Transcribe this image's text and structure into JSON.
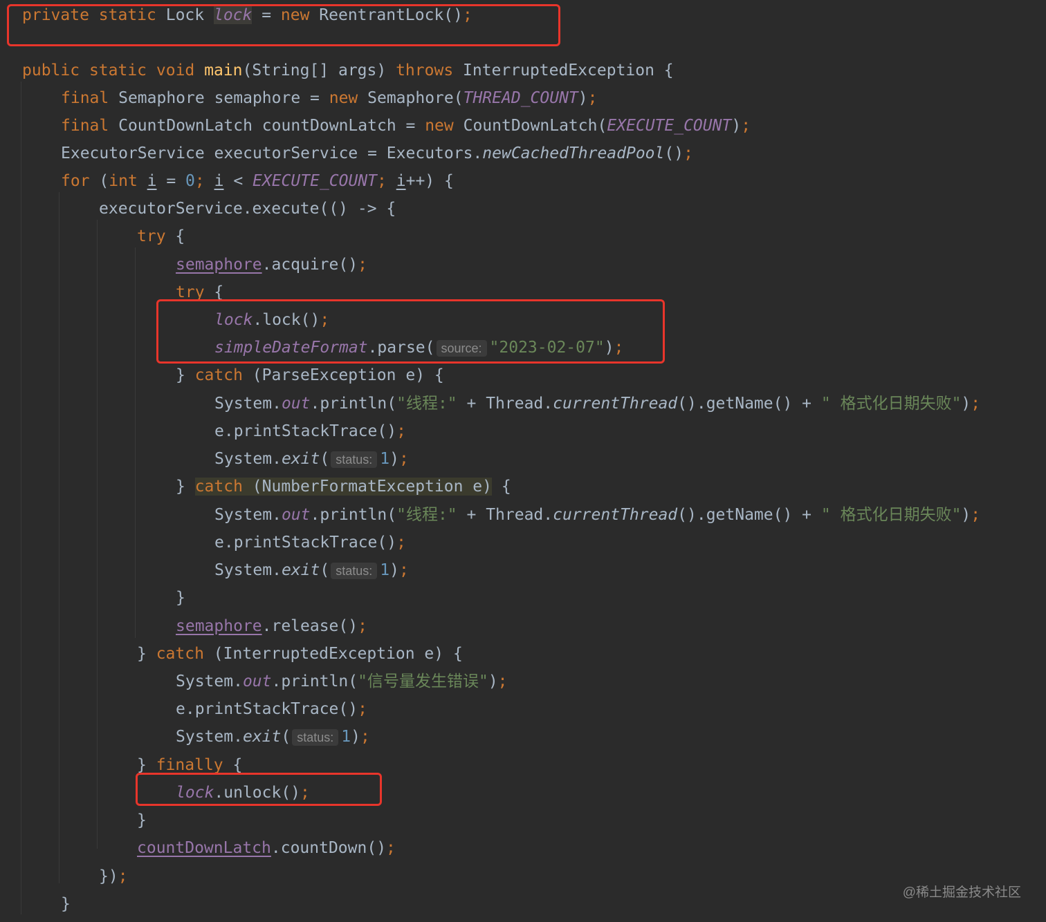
{
  "editor": {
    "theme": "Darcula",
    "colors": {
      "background": "#2b2b2b",
      "keyword": "#cc7832",
      "text": "#a9b7c6",
      "method_declaration": "#ffc66d",
      "static_field": "#9876aa",
      "string": "#6a8759",
      "number": "#6897bb",
      "parameter_hint": "#8c8c8c",
      "annotation_box": "#e8352b"
    },
    "lines": [
      [
        [
          "kw",
          "private "
        ],
        [
          "kw",
          "static "
        ],
        [
          "plain",
          "Lock "
        ],
        [
          "static_field_usage",
          "lock"
        ],
        [
          "plain",
          " = "
        ],
        [
          "kw",
          "new "
        ],
        [
          "plain",
          "ReentrantLock()"
        ],
        [
          "punc",
          ";"
        ]
      ],
      [
        [
          "kw",
          "public "
        ],
        [
          "kw",
          "static "
        ],
        [
          "kw",
          "void "
        ],
        [
          "fn",
          "main"
        ],
        [
          "plain",
          "(String[] args) "
        ],
        [
          "kw",
          "throws "
        ],
        [
          "plain",
          "InterruptedException {"
        ]
      ],
      [
        [
          "kw",
          "final "
        ],
        [
          "plain",
          "Semaphore semaphore = "
        ],
        [
          "kw",
          "new "
        ],
        [
          "plain",
          "Semaphore("
        ],
        [
          "static_field",
          "THREAD_COUNT"
        ],
        [
          "plain",
          ")"
        ],
        [
          "punc",
          ";"
        ]
      ],
      [
        [
          "kw",
          "final "
        ],
        [
          "plain",
          "CountDownLatch countDownLatch = "
        ],
        [
          "kw",
          "new "
        ],
        [
          "plain",
          "CountDownLatch("
        ],
        [
          "static_field",
          "EXECUTE_COUNT"
        ],
        [
          "plain",
          ")"
        ],
        [
          "punc",
          ";"
        ]
      ],
      [
        [
          "plain",
          "ExecutorService executorService = Executors."
        ],
        [
          "static_method",
          "newCachedThreadPool"
        ],
        [
          "plain",
          "()"
        ],
        [
          "punc",
          ";"
        ]
      ],
      [
        [
          "kw",
          "for "
        ],
        [
          "plain",
          "("
        ],
        [
          "kw",
          "int "
        ],
        [
          "var_ul",
          "i"
        ],
        [
          "plain",
          " = "
        ],
        [
          "number",
          "0"
        ],
        [
          "punc",
          "; "
        ],
        [
          "var_ul",
          "i"
        ],
        [
          "plain",
          " < "
        ],
        [
          "static_field",
          "EXECUTE_COUNT"
        ],
        [
          "punc",
          "; "
        ],
        [
          "var_ul",
          "i"
        ],
        [
          "plain",
          "++) {"
        ]
      ],
      [
        [
          "plain",
          "executorService.execute(() -> {"
        ]
      ],
      [
        [
          "kw",
          "try "
        ],
        [
          "plain",
          "{"
        ]
      ],
      [
        [
          "field_ul",
          "semaphore"
        ],
        [
          "plain",
          ".acquire()"
        ],
        [
          "punc",
          ";"
        ]
      ],
      [
        [
          "kw",
          "try "
        ],
        [
          "plain",
          "{"
        ]
      ],
      [
        [
          "static_field",
          "lock"
        ],
        [
          "plain",
          ".lock()"
        ],
        [
          "punc",
          ";"
        ]
      ],
      [
        [
          "static_field",
          "simpleDateFormat"
        ],
        [
          "plain",
          ".parse("
        ],
        [
          "hint",
          "source:"
        ],
        [
          "string",
          "\"2023-02-07\""
        ],
        [
          "plain",
          ")"
        ],
        [
          "punc",
          ";"
        ]
      ],
      [
        [
          "plain",
          "} "
        ],
        [
          "kw",
          "catch "
        ],
        [
          "plain",
          "(ParseException e) {"
        ]
      ],
      [
        [
          "plain",
          "System."
        ],
        [
          "static_field",
          "out"
        ],
        [
          "plain",
          ".println("
        ],
        [
          "string",
          "\"线程:\""
        ],
        [
          "plain",
          " + Thread."
        ],
        [
          "static_method",
          "currentThread"
        ],
        [
          "plain",
          "().getName() + "
        ],
        [
          "string",
          "\" 格式化日期失败\""
        ],
        [
          "plain",
          ")"
        ],
        [
          "punc",
          ";"
        ]
      ],
      [
        [
          "plain",
          "e.printStackTrace()"
        ],
        [
          "punc",
          ";"
        ]
      ],
      [
        [
          "plain",
          "System."
        ],
        [
          "static_method",
          "exit"
        ],
        [
          "plain",
          "("
        ],
        [
          "hint",
          "status:"
        ],
        [
          "number",
          "1"
        ],
        [
          "plain",
          ")"
        ],
        [
          "punc",
          ";"
        ]
      ],
      [
        [
          "plain",
          "} "
        ],
        [
          "kw_catch_hl",
          "catch "
        ],
        [
          "catch_hl",
          "(NumberFormatException e)"
        ],
        [
          "plain",
          " {"
        ]
      ],
      [
        [
          "plain",
          "System."
        ],
        [
          "static_field",
          "out"
        ],
        [
          "plain",
          ".println("
        ],
        [
          "string",
          "\"线程:\""
        ],
        [
          "plain",
          " + Thread."
        ],
        [
          "static_method",
          "currentThread"
        ],
        [
          "plain",
          "().getName() + "
        ],
        [
          "string",
          "\" 格式化日期失败\""
        ],
        [
          "plain",
          ")"
        ],
        [
          "punc",
          ";"
        ]
      ],
      [
        [
          "plain",
          "e.printStackTrace()"
        ],
        [
          "punc",
          ";"
        ]
      ],
      [
        [
          "plain",
          "System."
        ],
        [
          "static_method",
          "exit"
        ],
        [
          "plain",
          "("
        ],
        [
          "hint",
          "status:"
        ],
        [
          "number",
          "1"
        ],
        [
          "plain",
          ")"
        ],
        [
          "punc",
          ";"
        ]
      ],
      [
        [
          "plain",
          "}"
        ]
      ],
      [
        [
          "field_ul",
          "semaphore"
        ],
        [
          "plain",
          ".release()"
        ],
        [
          "punc",
          ";"
        ]
      ],
      [
        [
          "plain",
          "} "
        ],
        [
          "kw",
          "catch "
        ],
        [
          "plain",
          "(InterruptedException e) {"
        ]
      ],
      [
        [
          "plain",
          "System."
        ],
        [
          "static_field",
          "out"
        ],
        [
          "plain",
          ".println("
        ],
        [
          "string",
          "\"信号量发生错误\""
        ],
        [
          "plain",
          ")"
        ],
        [
          "punc",
          ";"
        ]
      ],
      [
        [
          "plain",
          "e.printStackTrace()"
        ],
        [
          "punc",
          ";"
        ]
      ],
      [
        [
          "plain",
          "System."
        ],
        [
          "static_method",
          "exit"
        ],
        [
          "plain",
          "("
        ],
        [
          "hint",
          "status:"
        ],
        [
          "number",
          "1"
        ],
        [
          "plain",
          ")"
        ],
        [
          "punc",
          ";"
        ]
      ],
      [
        [
          "plain",
          "} "
        ],
        [
          "kw",
          "finally "
        ],
        [
          "plain",
          "{"
        ]
      ],
      [
        [
          "static_field",
          "lock"
        ],
        [
          "plain",
          ".unlock()"
        ],
        [
          "punc",
          ";"
        ]
      ],
      [
        [
          "plain",
          "}"
        ]
      ],
      [
        [
          "field_ul",
          "countDownLatch"
        ],
        [
          "plain",
          ".countDown()"
        ],
        [
          "punc",
          ";"
        ]
      ],
      [
        [
          "plain",
          "})"
        ],
        [
          "punc",
          ";"
        ]
      ],
      [
        [
          "plain",
          "}"
        ]
      ]
    ]
  },
  "watermark": "@稀土掘金技术社区"
}
